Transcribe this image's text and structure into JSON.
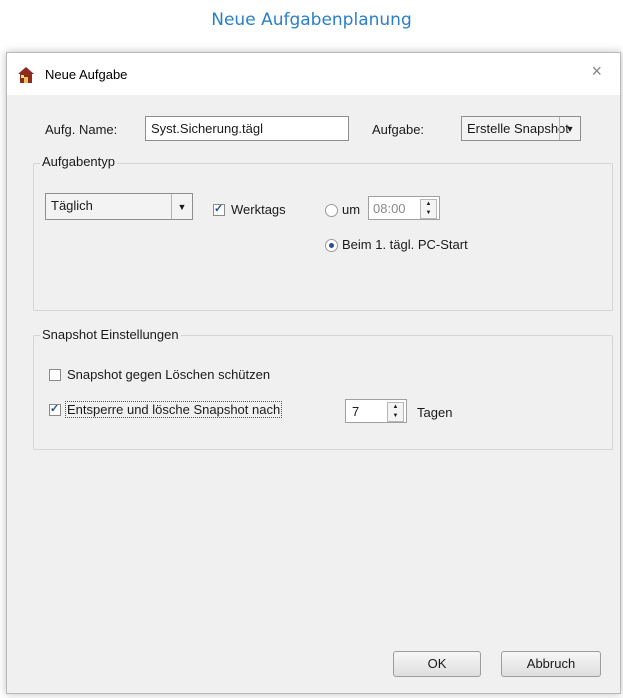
{
  "page_title": "Neue Aufgabenplanung",
  "window": {
    "title": "Neue Aufgabe",
    "close_glyph": "×"
  },
  "name_row": {
    "name_label": "Aufg. Name:",
    "name_value": "Syst.Sicherung.tägl",
    "task_label": "Aufgabe:",
    "task_value": "Erstelle Snapshot"
  },
  "task_type": {
    "group_title": "Aufgabentyp",
    "frequency_value": "Täglich",
    "weekdays_label": "Werktags",
    "weekdays_checked": true,
    "at_label": "um",
    "time_value": "08:00",
    "at_selected": false,
    "pc_start_label": "Beim 1. tägl. PC-Start",
    "pc_start_selected": true
  },
  "snapshot": {
    "group_title": "Snapshot Einstellungen",
    "protect_label": "Snapshot gegen Löschen schützen",
    "protect_checked": false,
    "unlock_label": "Entsperre und lösche Snapshot nach",
    "unlock_checked": true,
    "days_value": "7",
    "days_label": "Tagen"
  },
  "buttons": {
    "ok": "OK",
    "cancel": "Abbruch"
  },
  "icons": {
    "app": "house-icon",
    "close": "close-icon",
    "dropdown": "chevron-down-icon",
    "spin": "spinner-arrows-icon"
  }
}
